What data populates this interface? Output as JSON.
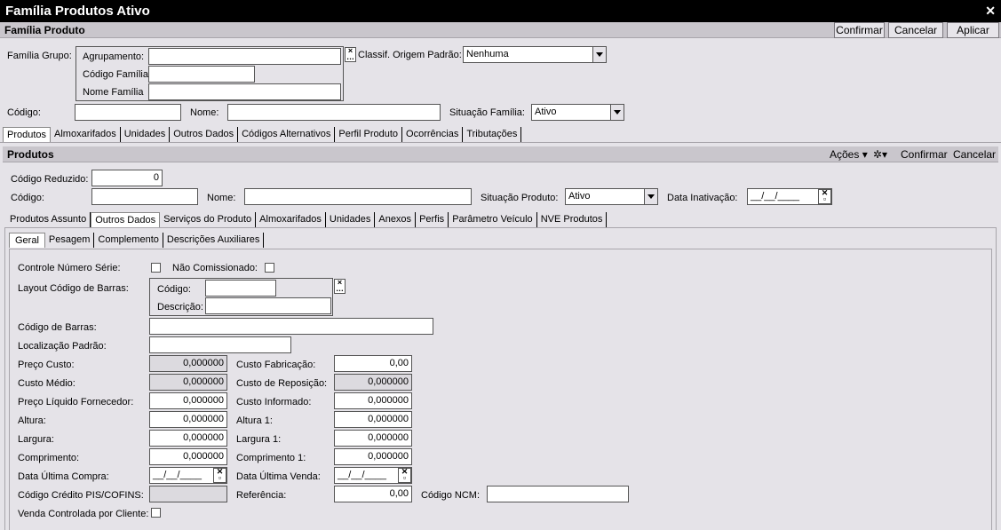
{
  "window": {
    "title": "Família Produtos Ativo"
  },
  "familia": {
    "header": "Família Produto",
    "buttons": {
      "confirm": "Confirmar",
      "cancel": "Cancelar",
      "apply": "Aplicar"
    },
    "grupo_label": "Família Grupo:",
    "agrupamento_label": "Agrupamento:",
    "agrupamento_value": "",
    "codigo_familia_label": "Código Família",
    "codigo_familia_value": "",
    "nome_familia_label": "Nome Família",
    "nome_familia_value": "",
    "classif_label": "Classif. Origem Padrão:",
    "classif_value": "Nenhuma",
    "codigo_label": "Código:",
    "codigo_value": "",
    "nome_label": "Nome:",
    "nome_value": "",
    "situacao_label": "Situação Família:",
    "situacao_value": "Ativo"
  },
  "main_tabs": [
    "Produtos",
    "Almoxarifados",
    "Unidades",
    "Outros Dados",
    "Códigos Alternativos",
    "Perfil Produto",
    "Ocorrências",
    "Tributações"
  ],
  "produtos": {
    "header": "Produtos",
    "actions_label": "Ações",
    "confirm": "Confirmar",
    "cancel": "Cancelar",
    "codigo_reduzido_label": "Código Reduzido:",
    "codigo_reduzido_value": "0",
    "codigo_label": "Código:",
    "codigo_value": "",
    "nome_label": "Nome:",
    "nome_value": "",
    "situacao_label": "Situação Produto:",
    "situacao_value": "Ativo",
    "data_inativacao_label": "Data Inativação:",
    "data_inativacao_value": "__/__/____"
  },
  "produto_tabs": [
    "Produtos Assunto",
    "Outros Dados",
    "Serviços do Produto",
    "Almoxarifados",
    "Unidades",
    "Anexos",
    "Perfis",
    "Parâmetro Veículo",
    "NVE Produtos"
  ],
  "outros_tabs": [
    "Geral",
    "Pesagem",
    "Complemento",
    "Descrições Auxiliares"
  ],
  "geral": {
    "controle_serie_label": "Controle Número Série:",
    "nao_comissionado_label": "Não Comissionado:",
    "layout_label": "Layout Código de Barras:",
    "layout_codigo_label": "Código:",
    "layout_codigo_value": "",
    "layout_descricao_label": "Descrição:",
    "layout_descricao_value": "",
    "codigo_barras_label": "Código de Barras:",
    "codigo_barras_value": "",
    "localizacao_label": "Localização Padrão:",
    "localizacao_value": "",
    "preco_custo_label": "Preço Custo:",
    "preco_custo_value": "0,000000",
    "custo_medio_label": "Custo Médio:",
    "custo_medio_value": "0,000000",
    "preco_liquido_label": "Preço Líquido Fornecedor:",
    "preco_liquido_value": "0,000000",
    "altura_label": "Altura:",
    "altura_value": "0,000000",
    "largura_label": "Largura:",
    "largura_value": "0,000000",
    "comprimento_label": "Comprimento:",
    "comprimento_value": "0,000000",
    "data_ultima_compra_label": "Data Última Compra:",
    "data_ultima_compra_value": "__/__/____",
    "credito_pis_label": "Código Crédito PIS/COFINS:",
    "credito_pis_value": "",
    "venda_controlada_label": "Venda Controlada por Cliente:",
    "custo_fabricacao_label": "Custo Fabricação:",
    "custo_fabricacao_value": "0,00",
    "custo_reposicao_label": "Custo de Reposição:",
    "custo_reposicao_value": "0,000000",
    "custo_informado_label": "Custo Informado:",
    "custo_informado_value": "0,000000",
    "altura1_label": "Altura 1:",
    "altura1_value": "0,000000",
    "largura1_label": "Largura 1:",
    "largura1_value": "0,000000",
    "comprimento1_label": "Comprimento 1:",
    "comprimento1_value": "0,000000",
    "data_ultima_venda_label": "Data Última Venda:",
    "data_ultima_venda_value": "__/__/____",
    "referencia_label": "Referência:",
    "referencia_value": "0,00",
    "codigo_ncm_label": "Código NCM:",
    "codigo_ncm_value": ""
  }
}
